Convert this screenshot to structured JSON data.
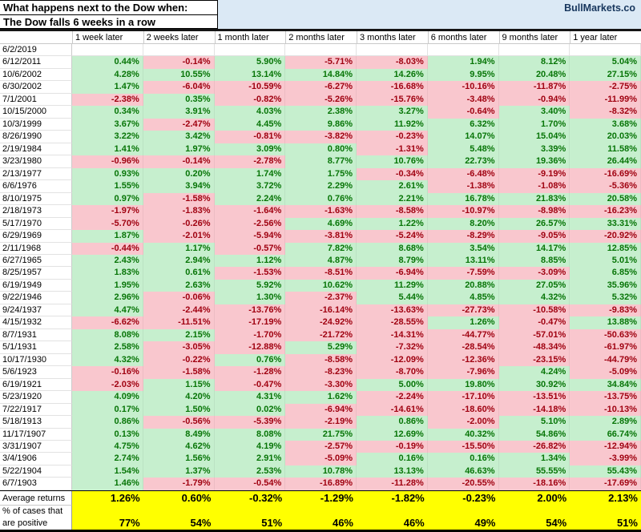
{
  "header": {
    "title_line1": "What happens next to the Dow when:",
    "title_line2": "The Dow falls 6 weeks in a row",
    "brand": "BullMarkets.co"
  },
  "colors": {
    "band_blue": "#dbe9f5",
    "brand_navy": "#17365d",
    "positive_bg": "#c6efce",
    "positive_text": "#077507",
    "negative_bg": "#f9c7ce",
    "negative_text": "#a00211",
    "summary_yellow": "#ffff00"
  },
  "chart_data": {
    "type": "table",
    "title": "What happens next to the Dow when: The Dow falls 6 weeks in a row",
    "color_coding": {
      "green": "positive return",
      "pink": "negative return"
    },
    "columns": [
      "1 week later",
      "2 weeks later",
      "1 month later",
      "2 months later",
      "3 months later",
      "6 months later",
      "9 months later",
      "1 year later"
    ],
    "rows": [
      {
        "date": "6/2/2019",
        "values": [
          "",
          "",
          "",
          "",
          "",
          "",
          "",
          ""
        ]
      },
      {
        "date": "6/12/2011",
        "values": [
          "0.44%",
          "-0.14%",
          "5.90%",
          "-5.71%",
          "-8.03%",
          "1.94%",
          "8.12%",
          "5.04%"
        ]
      },
      {
        "date": "10/6/2002",
        "values": [
          "4.28%",
          "10.55%",
          "13.14%",
          "14.84%",
          "14.26%",
          "9.95%",
          "20.48%",
          "27.15%"
        ]
      },
      {
        "date": "6/30/2002",
        "values": [
          "1.47%",
          "-6.04%",
          "-10.59%",
          "-6.27%",
          "-16.68%",
          "-10.16%",
          "-11.87%",
          "-2.75%"
        ]
      },
      {
        "date": "7/1/2001",
        "values": [
          "-2.38%",
          "0.35%",
          "-0.82%",
          "-5.26%",
          "-15.76%",
          "-3.48%",
          "-0.94%",
          "-11.99%"
        ]
      },
      {
        "date": "10/15/2000",
        "values": [
          "0.34%",
          "3.91%",
          "4.03%",
          "2.38%",
          "3.27%",
          "-0.64%",
          "3.40%",
          "-8.32%"
        ]
      },
      {
        "date": "10/3/1999",
        "values": [
          "3.67%",
          "-2.47%",
          "4.45%",
          "9.86%",
          "11.92%",
          "6.32%",
          "1.70%",
          "3.68%"
        ]
      },
      {
        "date": "8/26/1990",
        "values": [
          "3.22%",
          "3.42%",
          "-0.81%",
          "-3.82%",
          "-0.23%",
          "14.07%",
          "15.04%",
          "20.03%"
        ]
      },
      {
        "date": "2/19/1984",
        "values": [
          "1.41%",
          "1.97%",
          "3.09%",
          "0.80%",
          "-1.31%",
          "5.48%",
          "3.39%",
          "11.58%"
        ]
      },
      {
        "date": "3/23/1980",
        "values": [
          "-0.96%",
          "-0.14%",
          "-2.78%",
          "8.77%",
          "10.76%",
          "22.73%",
          "19.36%",
          "26.44%"
        ]
      },
      {
        "date": "2/13/1977",
        "values": [
          "0.93%",
          "0.20%",
          "1.74%",
          "1.75%",
          "-0.34%",
          "-6.48%",
          "-9.19%",
          "-16.69%"
        ]
      },
      {
        "date": "6/6/1976",
        "values": [
          "1.55%",
          "3.94%",
          "3.72%",
          "2.29%",
          "2.61%",
          "-1.38%",
          "-1.08%",
          "-5.36%"
        ]
      },
      {
        "date": "8/10/1975",
        "values": [
          "0.97%",
          "-1.58%",
          "2.24%",
          "0.76%",
          "2.21%",
          "16.78%",
          "21.83%",
          "20.58%"
        ]
      },
      {
        "date": "2/18/1973",
        "values": [
          "-1.97%",
          "-1.83%",
          "-1.64%",
          "-1.63%",
          "-8.58%",
          "-10.97%",
          "-8.98%",
          "-16.23%"
        ]
      },
      {
        "date": "5/17/1970",
        "values": [
          "-5.70%",
          "-0.26%",
          "-2.56%",
          "4.69%",
          "1.22%",
          "8.20%",
          "26.57%",
          "33.31%"
        ]
      },
      {
        "date": "6/29/1969",
        "values": [
          "1.87%",
          "-2.01%",
          "-5.94%",
          "-3.81%",
          "-5.24%",
          "-8.29%",
          "-9.05%",
          "-20.92%"
        ]
      },
      {
        "date": "2/11/1968",
        "values": [
          "-0.44%",
          "1.17%",
          "-0.57%",
          "7.82%",
          "8.68%",
          "3.54%",
          "14.17%",
          "12.85%"
        ]
      },
      {
        "date": "6/27/1965",
        "values": [
          "2.43%",
          "2.94%",
          "1.12%",
          "4.87%",
          "8.79%",
          "13.11%",
          "8.85%",
          "5.01%"
        ]
      },
      {
        "date": "8/25/1957",
        "values": [
          "1.83%",
          "0.61%",
          "-1.53%",
          "-8.51%",
          "-6.94%",
          "-7.59%",
          "-3.09%",
          "6.85%"
        ]
      },
      {
        "date": "6/19/1949",
        "values": [
          "1.95%",
          "2.63%",
          "5.92%",
          "10.62%",
          "11.29%",
          "20.88%",
          "27.05%",
          "35.96%"
        ]
      },
      {
        "date": "9/22/1946",
        "values": [
          "2.96%",
          "-0.06%",
          "1.30%",
          "-2.37%",
          "5.44%",
          "4.85%",
          "4.32%",
          "5.32%"
        ]
      },
      {
        "date": "9/24/1937",
        "values": [
          "4.47%",
          "-2.44%",
          "-13.76%",
          "-16.14%",
          "-13.63%",
          "-27.73%",
          "-10.58%",
          "-9.83%"
        ]
      },
      {
        "date": "4/15/1932",
        "values": [
          "-6.62%",
          "-11.51%",
          "-17.19%",
          "-24.92%",
          "-28.55%",
          "1.26%",
          "-0.47%",
          "13.88%"
        ]
      },
      {
        "date": "8/7/1931",
        "values": [
          "8.08%",
          "2.15%",
          "-1.70%",
          "-21.72%",
          "-14.31%",
          "-44.77%",
          "-57.01%",
          "-50.63%"
        ]
      },
      {
        "date": "5/1/1931",
        "values": [
          "2.58%",
          "-3.05%",
          "-12.88%",
          "5.29%",
          "-7.32%",
          "-28.54%",
          "-48.34%",
          "-61.97%"
        ]
      },
      {
        "date": "10/17/1930",
        "values": [
          "4.32%",
          "-0.22%",
          "0.76%",
          "-8.58%",
          "-12.09%",
          "-12.36%",
          "-23.15%",
          "-44.79%"
        ]
      },
      {
        "date": "5/6/1923",
        "values": [
          "-0.16%",
          "-1.58%",
          "-1.28%",
          "-8.23%",
          "-8.70%",
          "-7.96%",
          "4.24%",
          "-5.09%"
        ]
      },
      {
        "date": "6/19/1921",
        "values": [
          "-2.03%",
          "1.15%",
          "-0.47%",
          "-3.30%",
          "5.00%",
          "19.80%",
          "30.92%",
          "34.84%"
        ]
      },
      {
        "date": "5/23/1920",
        "values": [
          "4.09%",
          "4.20%",
          "4.31%",
          "1.62%",
          "-2.24%",
          "-17.10%",
          "-13.51%",
          "-13.75%"
        ]
      },
      {
        "date": "7/22/1917",
        "values": [
          "0.17%",
          "1.50%",
          "0.02%",
          "-6.94%",
          "-14.61%",
          "-18.60%",
          "-14.18%",
          "-10.13%"
        ]
      },
      {
        "date": "5/18/1913",
        "values": [
          "0.86%",
          "-0.56%",
          "-5.39%",
          "-2.19%",
          "0.86%",
          "-2.00%",
          "5.10%",
          "2.89%"
        ]
      },
      {
        "date": "11/17/1907",
        "values": [
          "0.13%",
          "8.49%",
          "8.08%",
          "21.75%",
          "12.69%",
          "40.32%",
          "54.86%",
          "66.74%"
        ]
      },
      {
        "date": "3/31/1907",
        "values": [
          "4.75%",
          "4.62%",
          "4.19%",
          "-2.57%",
          "-0.19%",
          "-15.50%",
          "-26.82%",
          "-12.94%"
        ]
      },
      {
        "date": "3/4/1906",
        "values": [
          "2.74%",
          "1.56%",
          "2.91%",
          "-5.09%",
          "0.16%",
          "0.16%",
          "1.34%",
          "-3.99%"
        ]
      },
      {
        "date": "5/22/1904",
        "values": [
          "1.54%",
          "1.37%",
          "2.53%",
          "10.78%",
          "13.13%",
          "46.63%",
          "55.55%",
          "55.43%"
        ]
      },
      {
        "date": "6/7/1903",
        "values": [
          "1.46%",
          "-1.79%",
          "-0.54%",
          "-16.89%",
          "-11.28%",
          "-20.55%",
          "-18.16%",
          "-17.69%"
        ]
      }
    ],
    "summary": {
      "average_label": "Average returns",
      "average_returns": [
        "1.26%",
        "0.60%",
        "-0.32%",
        "-1.29%",
        "-1.82%",
        "-0.23%",
        "2.00%",
        "2.13%"
      ],
      "percent_label_line1": "% of cases that",
      "percent_label_line2": "are positive",
      "percent_positive": [
        "77%",
        "54%",
        "51%",
        "46%",
        "46%",
        "49%",
        "54%",
        "51%"
      ]
    }
  }
}
